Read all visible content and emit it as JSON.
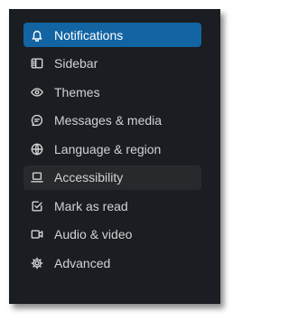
{
  "menu": {
    "items": [
      {
        "label": "Notifications",
        "icon": "bell-icon",
        "state": "active"
      },
      {
        "label": "Sidebar",
        "icon": "sidebar-icon",
        "state": "normal"
      },
      {
        "label": "Themes",
        "icon": "eye-icon",
        "state": "normal"
      },
      {
        "label": "Messages & media",
        "icon": "message-icon",
        "state": "normal"
      },
      {
        "label": "Language & region",
        "icon": "globe-icon",
        "state": "normal"
      },
      {
        "label": "Accessibility",
        "icon": "laptop-icon",
        "state": "hover"
      },
      {
        "label": "Mark as read",
        "icon": "check-square-icon",
        "state": "normal"
      },
      {
        "label": "Audio & video",
        "icon": "video-icon",
        "state": "normal"
      },
      {
        "label": "Advanced",
        "icon": "gear-icon",
        "state": "normal"
      }
    ]
  },
  "colors": {
    "background": "#1a1d21",
    "active": "#1264a3",
    "hover": "#27292d",
    "text": "#d1d2d3"
  }
}
